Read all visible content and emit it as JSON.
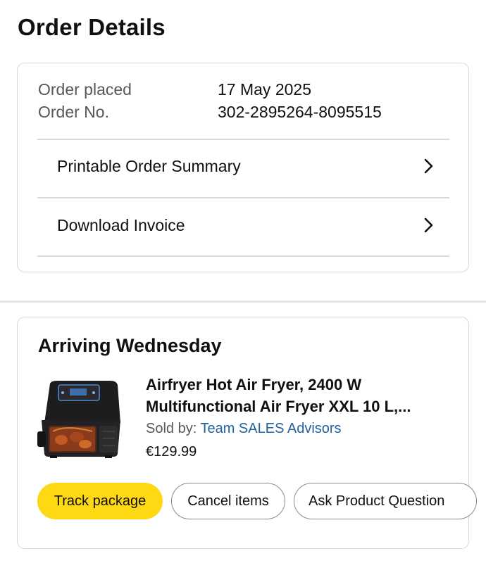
{
  "page": {
    "title": "Order Details"
  },
  "order": {
    "placed_label": "Order placed",
    "placed_value": "17 May 2025",
    "number_label": "Order No.",
    "number_value": "302-2895264-8095515",
    "links": [
      {
        "label": "Printable Order Summary",
        "icon": "chevron-right-icon"
      },
      {
        "label": "Download Invoice",
        "icon": "chevron-right-icon"
      }
    ]
  },
  "shipment": {
    "heading": "Arriving Wednesday",
    "product": {
      "title_line1": "Airfryer Hot Air Fryer, 2400 W",
      "title_line2": "Multifunctional Air Fryer XXL 10 L,...",
      "sold_by_label": "Sold by: ",
      "seller": "Team SALES Advisors",
      "price": "€129.99",
      "image_icon": "air-fryer-product-image"
    },
    "buttons": {
      "track": "Track package",
      "cancel": "Cancel items",
      "ask": "Ask Product Question"
    }
  },
  "colors": {
    "primary_button": "#ffd814",
    "link": "#2162a1",
    "secondary_text": "#565959",
    "border": "#d5d9d9"
  }
}
